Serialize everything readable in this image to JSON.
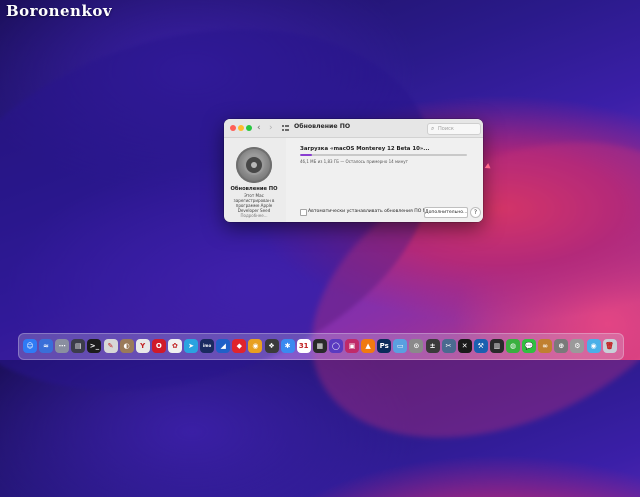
{
  "watermark": "Boronenkov",
  "window": {
    "title": "Обновление ПО",
    "search_placeholder": "Поиск",
    "nav_back": "‹",
    "nav_forward": "›"
  },
  "left_pane": {
    "title": "Обновление ПО",
    "description": "Этот Mac зарегистрирован в программе Apple Developer Seed",
    "learn_more": "Подробнее..."
  },
  "update": {
    "title": "Загрузка «macOS Monterey 12 Beta 10»...",
    "progress": 0.07,
    "status": "46,1 МБ из 1,83 ГБ — Осталось примерно 14 минут",
    "auto_label": "Автоматически устанавливать обновления ПО Mac",
    "auto_checked": false,
    "more_button": "Дополнительно...",
    "help_button": "?"
  },
  "dock": {
    "items": [
      {
        "name": "finder-icon",
        "glyph": "☺",
        "color": "#2f7bf5"
      },
      {
        "name": "stocks-icon",
        "glyph": "≈",
        "color": "#3a6fd8"
      },
      {
        "name": "launchpad-icon",
        "glyph": "⋯",
        "color": "#8a8fa0"
      },
      {
        "name": "mission-control-icon",
        "glyph": "▤",
        "color": "#3c3c4a"
      },
      {
        "name": "terminal-icon",
        "glyph": ">_",
        "color": "#1c1c1c"
      },
      {
        "name": "script-editor-icon",
        "glyph": "✎",
        "color": "#d7d7d7"
      },
      {
        "name": "contacts-icon",
        "glyph": "◐",
        "color": "#9a7a5a"
      },
      {
        "name": "yandex-browser-icon",
        "glyph": "Y",
        "color": "#e8e8e8"
      },
      {
        "name": "opera-icon",
        "glyph": "O",
        "color": "#d01a2a"
      },
      {
        "name": "photos-icon",
        "glyph": "✿",
        "color": "#f0f0f0"
      },
      {
        "name": "telegram-icon",
        "glyph": "➤",
        "color": "#2aa3e0"
      },
      {
        "name": "imo-icon",
        "glyph": "imo",
        "color": "#1a2a60"
      },
      {
        "name": "nord-icon",
        "glyph": "◢",
        "color": "#2060c8"
      },
      {
        "name": "anydesk-icon",
        "glyph": "◆",
        "color": "#e0242c"
      },
      {
        "name": "cinema-icon",
        "glyph": "◉",
        "color": "#e8a020"
      },
      {
        "name": "resolve-icon",
        "glyph": "❖",
        "color": "#3a3a3a"
      },
      {
        "name": "drive-icon",
        "glyph": "✱",
        "color": "#3a8af0"
      },
      {
        "name": "calendar-icon",
        "glyph": "31",
        "color": "#ffffff"
      },
      {
        "name": "final-cut-icon",
        "glyph": "▦",
        "color": "#2a2a2a"
      },
      {
        "name": "motion-icon",
        "glyph": "◯",
        "color": "#5a3ac0"
      },
      {
        "name": "compressor-icon",
        "glyph": "▣",
        "color": "#c02a6a"
      },
      {
        "name": "vlc-icon",
        "glyph": "▲",
        "color": "#f07a10"
      },
      {
        "name": "photoshop-icon",
        "glyph": "Ps",
        "color": "#0a2a5a"
      },
      {
        "name": "preview-icon",
        "glyph": "▭",
        "color": "#5aa0e0"
      },
      {
        "name": "disk-utility-icon",
        "glyph": "⊙",
        "color": "#8a8a8a"
      },
      {
        "name": "calculator-icon",
        "glyph": "±",
        "color": "#3a3a3a"
      },
      {
        "name": "instruments-icon",
        "glyph": "✂",
        "color": "#4a6a90"
      },
      {
        "name": "fcpx-icon",
        "glyph": "✕",
        "color": "#1a1a1a"
      },
      {
        "name": "tools-icon",
        "glyph": "⚒",
        "color": "#1a60b0"
      },
      {
        "name": "cleaner-icon",
        "glyph": "▥",
        "color": "#2a2a2a"
      },
      {
        "name": "frog-icon",
        "glyph": "◍",
        "color": "#3ab040"
      },
      {
        "name": "messages-icon",
        "glyph": "💬",
        "color": "#30c040"
      },
      {
        "name": "lasso-icon",
        "glyph": "∞",
        "color": "#c08030"
      },
      {
        "name": "utility-icon",
        "glyph": "⊕",
        "color": "#7a7a7a"
      },
      {
        "name": "network-icon",
        "glyph": "⚙",
        "color": "#9a9a9a"
      },
      {
        "name": "screenshot-icon",
        "glyph": "◉",
        "color": "#4ab0e8"
      },
      {
        "name": "trash-icon",
        "glyph": "🗑",
        "color": "#c8d0d8"
      }
    ]
  }
}
